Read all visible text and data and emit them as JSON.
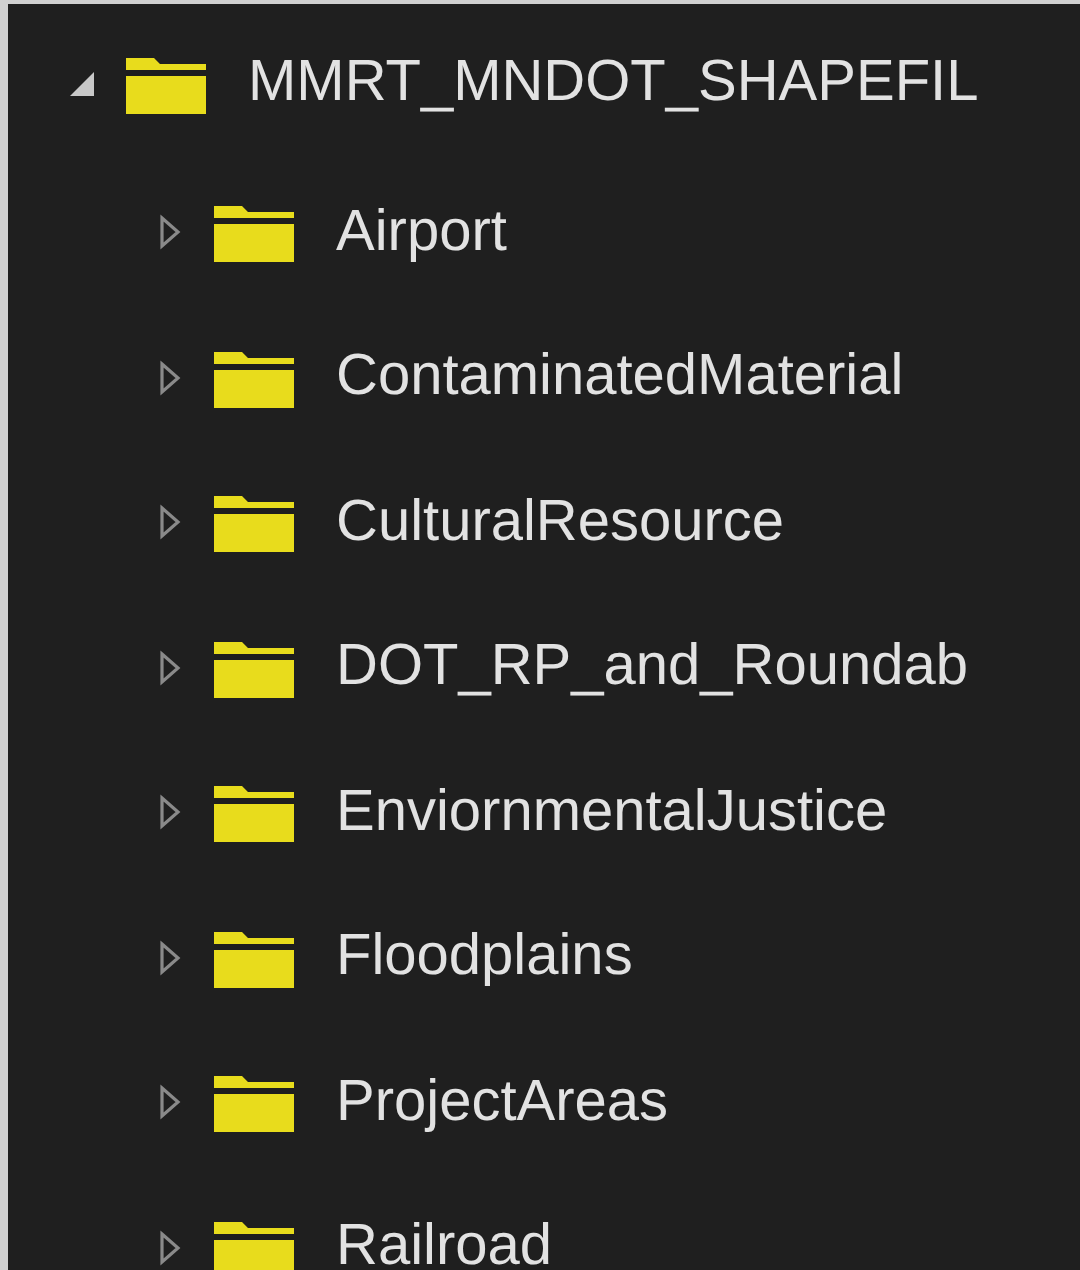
{
  "tree": [
    {
      "label": "MMRT_MNDOT_SHAPEFIL",
      "expanded": true,
      "children": [
        {
          "label": "Airport",
          "expanded": false
        },
        {
          "label": "ContaminatedMaterial",
          "expanded": false
        },
        {
          "label": "CulturalResource",
          "expanded": false
        },
        {
          "label": "DOT_RP_and_Roundab",
          "expanded": false
        },
        {
          "label": "EnviornmentalJustice",
          "expanded": false
        },
        {
          "label": "Floodplains",
          "expanded": false
        },
        {
          "label": "ProjectAreas",
          "expanded": false
        },
        {
          "label": "Railroad",
          "expanded": false
        }
      ]
    }
  ]
}
